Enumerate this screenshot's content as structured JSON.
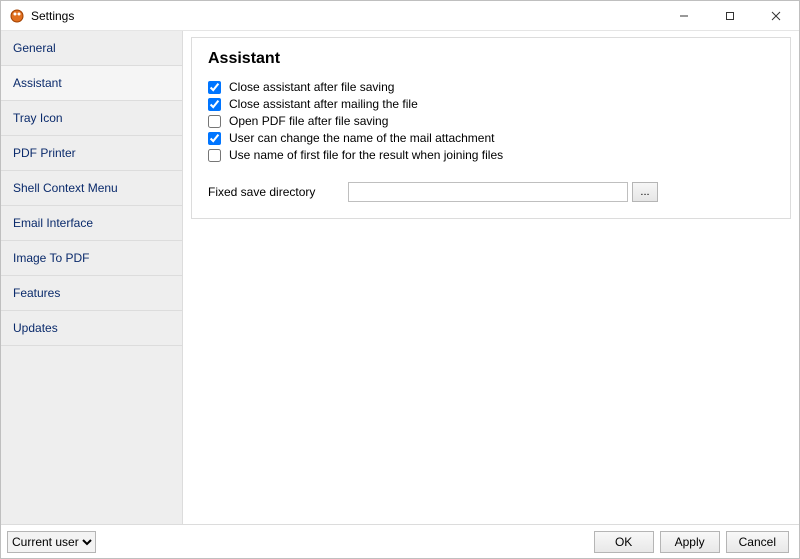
{
  "window": {
    "title": "Settings"
  },
  "sidebar": {
    "items": [
      {
        "label": "General"
      },
      {
        "label": "Assistant"
      },
      {
        "label": "Tray Icon"
      },
      {
        "label": "PDF Printer"
      },
      {
        "label": "Shell Context Menu"
      },
      {
        "label": "Email Interface"
      },
      {
        "label": "Image To PDF"
      },
      {
        "label": "Features"
      },
      {
        "label": "Updates"
      }
    ],
    "active_index": 1
  },
  "panel": {
    "heading": "Assistant",
    "checks": [
      {
        "label": "Close assistant after file saving",
        "checked": true
      },
      {
        "label": "Close assistant after mailing the file",
        "checked": true
      },
      {
        "label": "Open PDF file after file saving",
        "checked": false
      },
      {
        "label": "User can change the name of the mail attachment",
        "checked": true
      },
      {
        "label": "Use name of first file for the result when joining files",
        "checked": false
      }
    ],
    "fixed_dir_label": "Fixed save directory",
    "fixed_dir_value": "",
    "browse_label": "..."
  },
  "footer": {
    "scope_selected": "Current user",
    "ok": "OK",
    "apply": "Apply",
    "cancel": "Cancel"
  }
}
